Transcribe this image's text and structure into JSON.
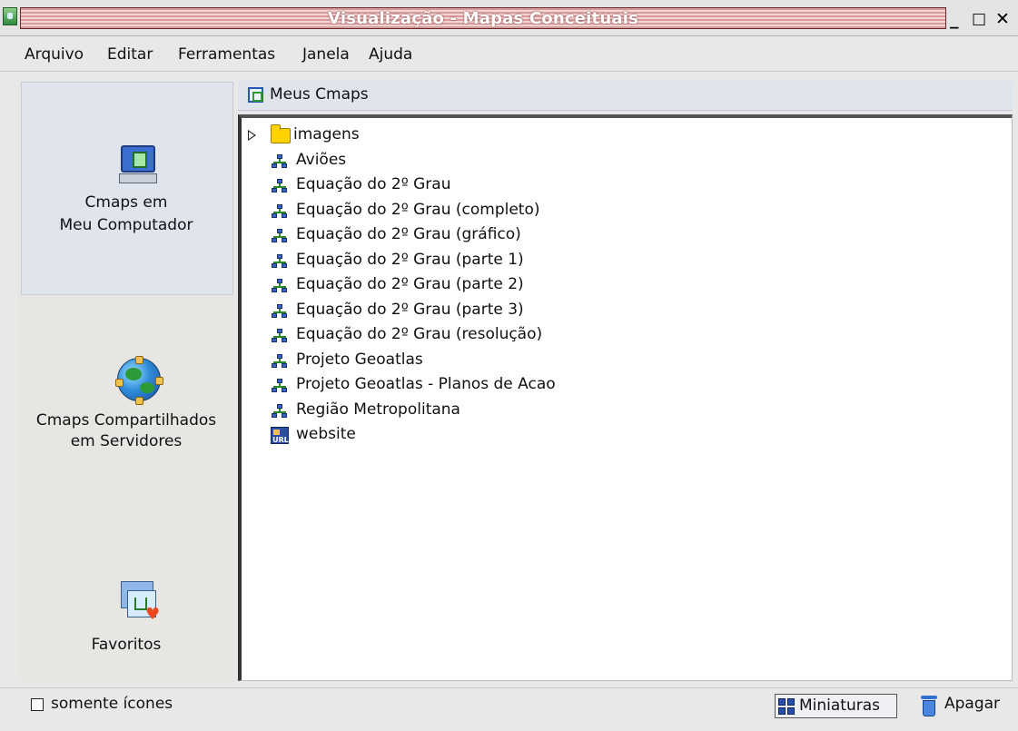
{
  "window": {
    "title": "Visualização - Mapas Conceituais",
    "minimize": "_",
    "maximize": "□",
    "close": "✕"
  },
  "menu": [
    {
      "label": "Arquivo"
    },
    {
      "label": "Editar"
    },
    {
      "label": "Ferramentas"
    },
    {
      "label": "Janela"
    },
    {
      "label": "Ajuda"
    }
  ],
  "nav": {
    "my_computer": {
      "line1": "Cmaps em",
      "line2": "Meu Computador",
      "icon": "computer-icon",
      "selected": true
    },
    "shared": {
      "line1": "Cmaps Compartilhados",
      "line2": "em Servidores",
      "icon": "globe-network-icon"
    },
    "favorites": {
      "line1": "Favoritos",
      "icon": "favorites-icon"
    }
  },
  "content": {
    "header": "Meus Cmaps",
    "items": [
      {
        "label": "imagens",
        "type": "folder",
        "collapsed": true
      },
      {
        "label": "Aviões",
        "type": "cmap"
      },
      {
        "label": "Equação do 2º Grau",
        "type": "cmap"
      },
      {
        "label": "Equação do 2º Grau (completo)",
        "type": "cmap"
      },
      {
        "label": "Equação do 2º Grau (gráfico)",
        "type": "cmap"
      },
      {
        "label": "Equação do 2º Grau (parte 1)",
        "type": "cmap"
      },
      {
        "label": "Equação do 2º Grau (parte 2)",
        "type": "cmap"
      },
      {
        "label": "Equação do 2º Grau (parte 3)",
        "type": "cmap"
      },
      {
        "label": "Equação do 2º Grau (resolução)",
        "type": "cmap"
      },
      {
        "label": "Projeto Geoatlas",
        "type": "cmap"
      },
      {
        "label": "Projeto Geoatlas - Planos de Acao",
        "type": "cmap"
      },
      {
        "label": "Região Metropolitana",
        "type": "cmap"
      },
      {
        "label": "website",
        "type": "url"
      }
    ]
  },
  "bottom": {
    "only_icons_label": "somente ícones",
    "only_icons_checked": false,
    "thumbnails_label": "Miniaturas",
    "delete_label": "Apagar"
  }
}
